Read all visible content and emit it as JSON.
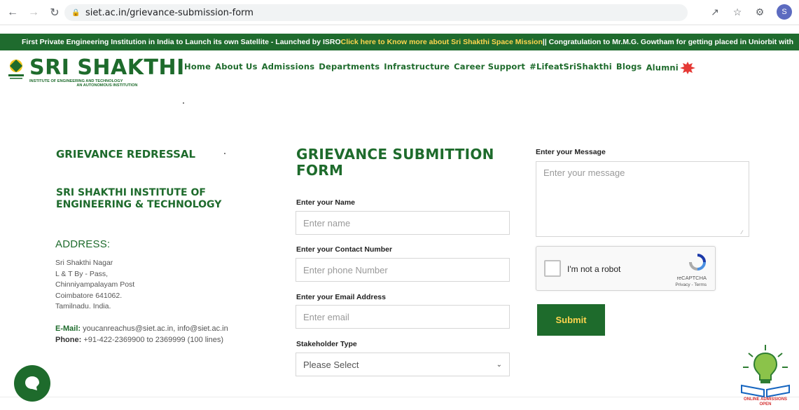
{
  "browser": {
    "url": "siet.ac.in/grievance-submission-form",
    "profile_initial": "S"
  },
  "ticker": {
    "text_before": "First Private Engineering Institution in India to Launch its own Satellite - Launched by ISRO ",
    "highlight": "Click here to Know more about Sri Shakthi Space Mission",
    "text_after": " || Congratulation to Mr.M.G. Gowtham for getting placed in Uniorbit with"
  },
  "header": {
    "logo_title": "SRI SHAKTHI",
    "logo_sub1": "INSTITUTE OF ENGINEERING AND TECHNOLOGY",
    "logo_sub2": "AN AUTONOMOUS INSTITUTION",
    "menu": [
      "Home",
      "About Us",
      "Admissions",
      "Departments",
      "Infrastructure",
      "Career Support",
      "#LifeatSriShakthi",
      "Blogs",
      "Alumni"
    ]
  },
  "left": {
    "heading": "GRIEVANCE REDRESSAL",
    "institution": "SRI SHAKTHI INSTITUTE OF ENGINEERING & TECHNOLOGY",
    "address_heading": "ADDRESS:",
    "address_lines": [
      "Sri Shakthi Nagar",
      "L & T By - Pass,",
      "Chinniyampalayam Post",
      "Coimbatore 641062.",
      "Tamilnadu. India."
    ],
    "email_label": "E-Mail:",
    "email_value": " youcanreachus@siet.ac.in, info@siet.ac.in",
    "phone_label": "Phone:",
    "phone_value": " +91-422-2369900 to 2369999 (100 lines)"
  },
  "form": {
    "title": "GRIEVANCE SUBMITTION FORM",
    "name_label": "Enter your Name",
    "name_placeholder": "Enter name",
    "contact_label": "Enter your Contact Number",
    "contact_placeholder": "Enter phone Number",
    "email_label": "Enter your Email Address",
    "email_placeholder": "Enter email",
    "stakeholder_label": "Stakeholder Type",
    "stakeholder_value": "Please Select",
    "message_label": "Enter your Message",
    "message_placeholder": "Enter your message",
    "captcha_text": "I'm not a robot",
    "captcha_brand": "reCAPTCHA",
    "captcha_links": "Privacy - Terms",
    "submit_label": "Submit"
  },
  "admissions_badge": "ONLINE ADMISSIONS OPEN",
  "colors": {
    "brand_green": "#1e6b2c",
    "accent_yellow": "#ffd54f"
  }
}
